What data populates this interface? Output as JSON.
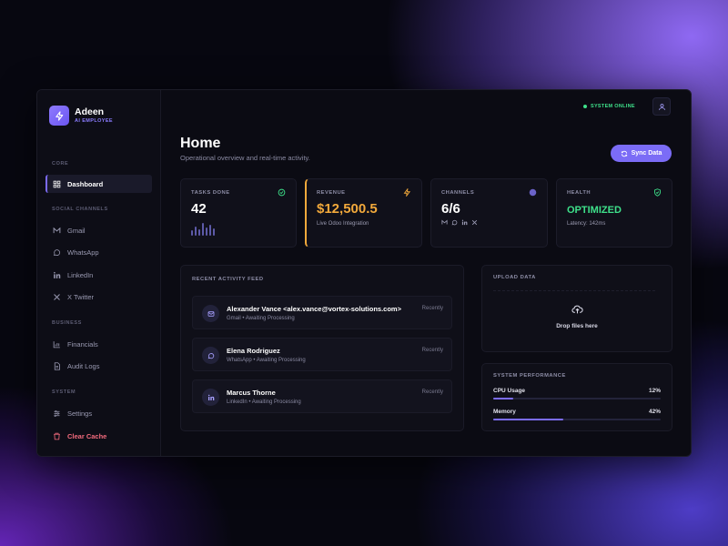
{
  "brand": {
    "name": "Adeen",
    "tagline": "AI EMPLOYEE"
  },
  "sidebar": {
    "sections": {
      "core": "CORE",
      "social": "SOCIAL CHANNELS",
      "business": "BUSINESS",
      "system": "SYSTEM"
    },
    "items": [
      {
        "label": "Dashboard",
        "icon": "grid-icon",
        "active": true
      },
      {
        "label": "Gmail",
        "icon": "gmail-icon"
      },
      {
        "label": "WhatsApp",
        "icon": "whatsapp-icon"
      },
      {
        "label": "LinkedIn",
        "icon": "linkedin-icon"
      },
      {
        "label": "X Twitter",
        "icon": "x-icon"
      },
      {
        "label": "Financials",
        "icon": "bar-chart-icon"
      },
      {
        "label": "Audit Logs",
        "icon": "document-icon"
      },
      {
        "label": "Settings",
        "icon": "sliders-icon"
      },
      {
        "label": "Clear Cache",
        "icon": "trash-icon",
        "danger": true
      }
    ]
  },
  "header": {
    "status": "SYSTEM ONLINE",
    "title": "Home",
    "subtitle": "Operational overview and real-time activity.",
    "sync_label": "Sync Data"
  },
  "stats": [
    {
      "label": "TASKS DONE",
      "value": "42",
      "icon": "check-circle-icon"
    },
    {
      "label": "REVENUE",
      "value": "$12,500.5",
      "note": "Live Odoo Integration",
      "icon": "bolt-icon"
    },
    {
      "label": "CHANNELS",
      "value": "6/6",
      "icon": "globe-icon"
    },
    {
      "label": "HEALTH",
      "value": "OPTIMIZED",
      "note": "Latency: 142ms",
      "icon": "shield-icon"
    }
  ],
  "activity": {
    "title": "RECENT ACTIVITY FEED",
    "items": [
      {
        "name": "Alexander Vance <alex.vance@vortex-solutions.com>",
        "meta": "Gmail • Awaiting Processing",
        "time": "Recently",
        "icon": "mail-icon"
      },
      {
        "name": "Elena Rodriguez",
        "meta": "WhatsApp • Awaiting Processing",
        "time": "Recently",
        "icon": "whatsapp-icon"
      },
      {
        "name": "Marcus Thorne",
        "meta": "LinkedIn • Awaiting Processing",
        "time": "Recently",
        "icon": "linkedin-icon"
      }
    ]
  },
  "upload": {
    "title": "UPLOAD DATA",
    "drop_label": "Drop files here"
  },
  "performance": {
    "title": "SYSTEM PERFORMANCE",
    "metrics": [
      {
        "label": "CPU Usage",
        "value": "12%",
        "fraction": 0.12
      },
      {
        "label": "Memory",
        "value": "42%",
        "fraction": 0.42
      }
    ]
  },
  "colors": {
    "accent": "#7b6cf6",
    "online": "#3ee08a",
    "revenue": "#f2a93b",
    "danger": "#f36b7d"
  }
}
